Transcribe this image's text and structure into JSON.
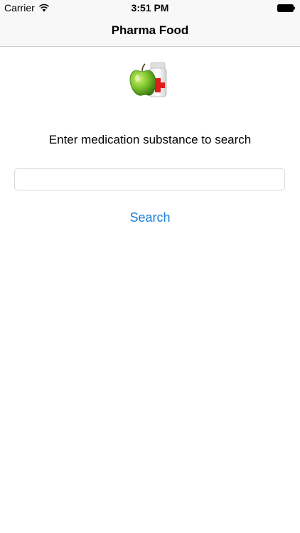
{
  "status_bar": {
    "carrier": "Carrier",
    "time": "3:51 PM",
    "wifi_icon": "wifi-icon",
    "battery_icon": "battery-icon"
  },
  "nav_bar": {
    "title": "Pharma Food"
  },
  "logo": {
    "icon": "apple-medicine-bottle-icon"
  },
  "main": {
    "prompt": "Enter medication substance to search",
    "search_input": {
      "value": "",
      "placeholder": ""
    },
    "search_button_label": "Search"
  },
  "colors": {
    "accent": "#1b7fd8",
    "nav_background": "#f8f8f8"
  }
}
